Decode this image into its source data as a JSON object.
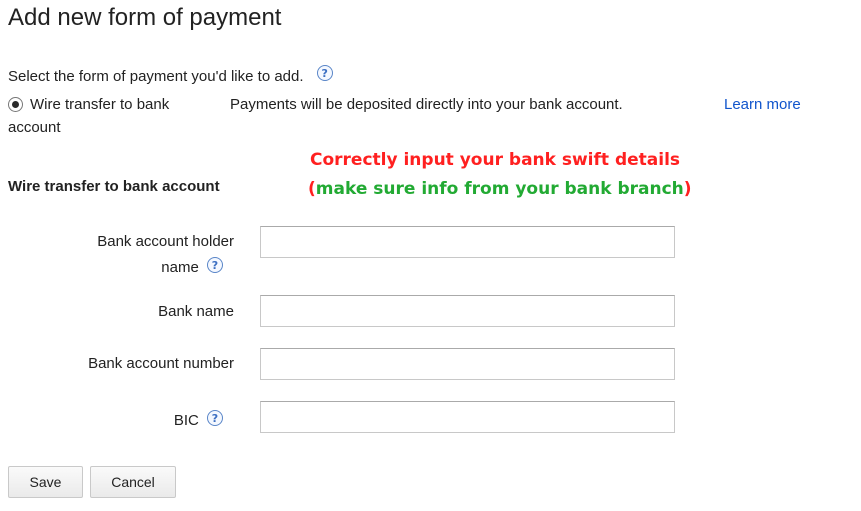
{
  "page": {
    "title": "Add new form of payment",
    "prompt": "Select the form of payment you'd like to add.",
    "help_glyph": "?"
  },
  "payment_option": {
    "label_line1": "Wire transfer to bank",
    "label_line2": "account",
    "description": "Payments will be deposited directly into your bank account.",
    "learn_more": "Learn more",
    "selected": true
  },
  "section": {
    "title": "Wire transfer to bank account"
  },
  "annotation": {
    "line1": "Correctly input your bank swift details",
    "line2_open": "(",
    "line2_text": "make sure info from your bank branch",
    "line2_close": ")",
    "colors": {
      "red": "#ff2020",
      "green": "#22aa33"
    }
  },
  "form": {
    "holder_label_line1": "Bank account holder",
    "holder_label_line2": "name",
    "holder_value": "",
    "bank_name_label": "Bank name",
    "bank_name_value": "",
    "account_number_label": "Bank account number",
    "account_number_value": "",
    "bic_label": "BIC",
    "bic_value": ""
  },
  "actions": {
    "save_label": "Save",
    "cancel_label": "Cancel"
  },
  "colors": {
    "link": "#1155cc",
    "help_icon": "#3c6fc2"
  }
}
